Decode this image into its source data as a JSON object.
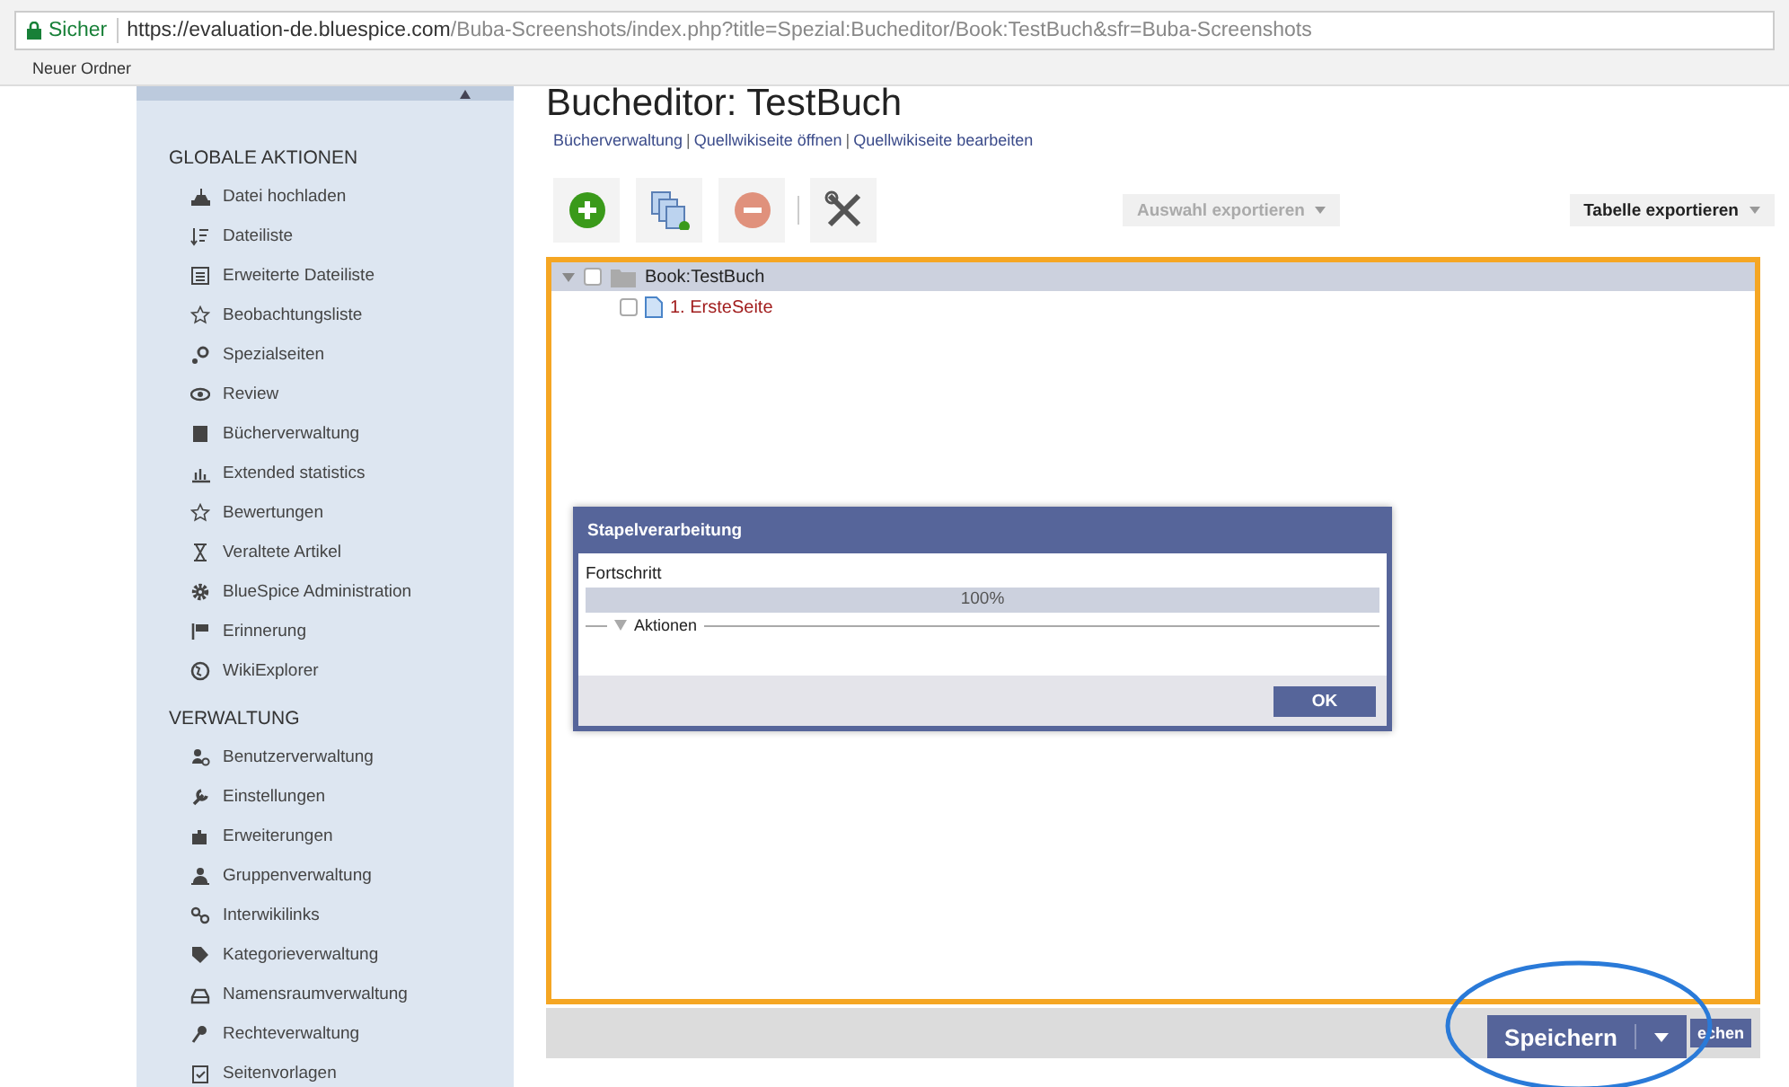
{
  "browser": {
    "security_label": "Sicher",
    "url_host": "https://evaluation-de.bluespice.com",
    "url_path": "/Buba-Screenshots/index.php?title=Spezial:Bucheditor/Book:TestBuch&sfr=Buba-Screenshots",
    "bookmarks": [
      "Neuer Ordner"
    ]
  },
  "sidebar": {
    "sections": [
      {
        "title": "GLOBALE AKTIONEN",
        "items": [
          "Datei hochladen",
          "Dateiliste",
          "Erweiterte Dateiliste",
          "Beobachtungsliste",
          "Spezialseiten",
          "Review",
          "Bücherverwaltung",
          "Extended statistics",
          "Bewertungen",
          "Veraltete Artikel",
          "BlueSpice Administration",
          "Erinnerung",
          "WikiExplorer"
        ]
      },
      {
        "title": "VERWALTUNG",
        "items": [
          "Benutzerverwaltung",
          "Einstellungen",
          "Erweiterungen",
          "Gruppenverwaltung",
          "Interwikilinks",
          "Kategorieverwaltung",
          "Namensraumverwaltung",
          "Rechteverwaltung",
          "Seitenvorlagen"
        ]
      }
    ]
  },
  "page": {
    "title": "Bucheditor: TestBuch",
    "links": [
      "Bücherverwaltung",
      "Quellwikiseite öffnen",
      "Quellwikiseite bearbeiten"
    ],
    "link_separator": "|"
  },
  "toolbar": {
    "export_selection": {
      "label": "Auswahl exportieren",
      "disabled": true
    },
    "export_table": {
      "label": "Tabelle exportieren",
      "disabled": false
    }
  },
  "tree": {
    "label": "Book:TestBuch",
    "expanded": true,
    "checked": false,
    "children": [
      {
        "label": "1. ErsteSeite",
        "checked": false
      }
    ]
  },
  "dialog": {
    "title": "Stapelverarbeitung",
    "progress_label": "Fortschritt",
    "progress": {
      "level": 1.0,
      "reading": "100%"
    },
    "fieldset": {
      "label": "Aktionen",
      "expanded": false
    },
    "button": "OK"
  },
  "footer": {
    "save_button": "Speichern",
    "partial_button": "echen"
  }
}
